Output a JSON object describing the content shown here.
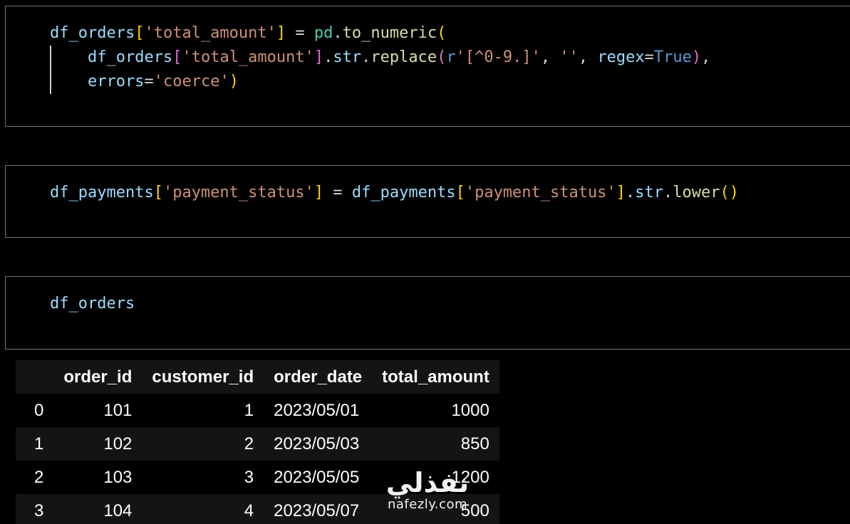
{
  "cells": [
    {
      "id": "cell-1",
      "lines": [
        "df_orders['total_amount'] = pd.to_numeric(",
        "    df_orders['total_amount'].str.replace(r'[^0-9.]', '', regex=True),",
        "    errors='coerce')"
      ]
    },
    {
      "id": "cell-2",
      "lines": [
        "df_payments['payment_status'] = df_payments['payment_status'].str.lower()"
      ]
    },
    {
      "id": "cell-3",
      "lines": [
        "df_orders"
      ]
    }
  ],
  "output_table": {
    "columns": [
      "",
      "order_id",
      "customer_id",
      "order_date",
      "total_amount"
    ],
    "rows": [
      [
        "0",
        "101",
        "1",
        "2023/05/01",
        "1000"
      ],
      [
        "1",
        "102",
        "2",
        "2023/05/03",
        "850"
      ],
      [
        "2",
        "103",
        "3",
        "2023/05/05",
        "1200"
      ],
      [
        "3",
        "104",
        "4",
        "2023/05/07",
        "500"
      ]
    ]
  },
  "watermark": {
    "arabic": "نفذلي",
    "domain": "nafezly.com"
  },
  "colors": {
    "background": "#000000",
    "cell_border": "#6b7586",
    "variable": "#9cdcfe",
    "function": "#dcdcaa",
    "string": "#ce9178",
    "keyword": "#569cd6",
    "module": "#4ec9b0",
    "bracket_level1": "#ffd700",
    "bracket_level2": "#da70d6"
  }
}
